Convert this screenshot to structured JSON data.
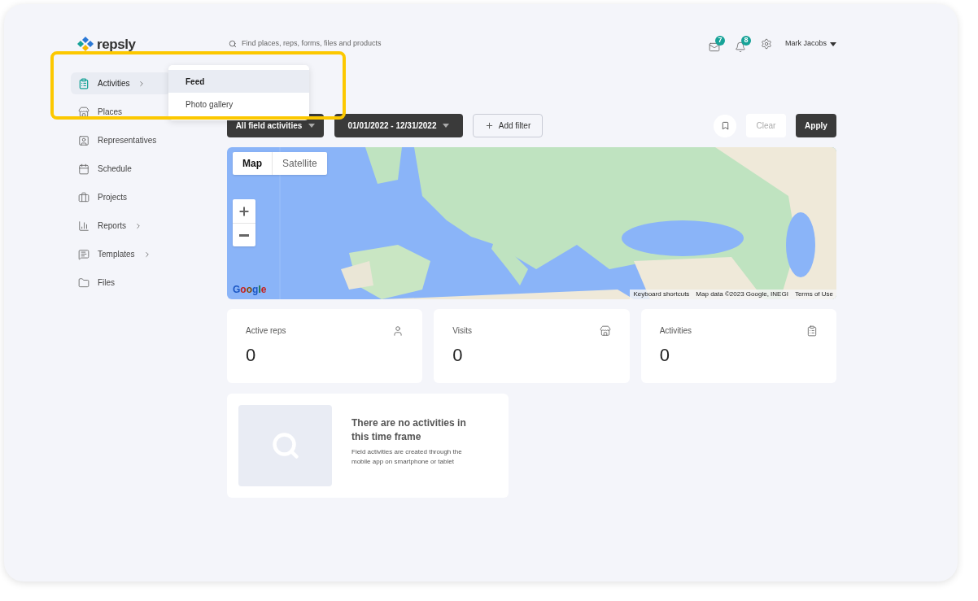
{
  "logo": {
    "text": "repsly"
  },
  "search": {
    "placeholder": "Find places, reps, forms, files and products"
  },
  "header": {
    "mail_count": "7",
    "notification_count": "8",
    "user_name": "Mark Jacobs"
  },
  "sidebar": {
    "items": [
      {
        "label": "Activities",
        "selected": true,
        "has_submenu": true
      },
      {
        "label": "Places",
        "selected": false,
        "has_submenu": false
      },
      {
        "label": "Representatives",
        "selected": false,
        "has_submenu": false
      },
      {
        "label": "Schedule",
        "selected": false,
        "has_submenu": false
      },
      {
        "label": "Projects",
        "selected": false,
        "has_submenu": false
      },
      {
        "label": "Reports",
        "selected": false,
        "has_submenu": true
      },
      {
        "label": "Templates",
        "selected": false,
        "has_submenu": true
      },
      {
        "label": "Files",
        "selected": false,
        "has_submenu": false
      }
    ]
  },
  "submenu": {
    "items": [
      {
        "label": "Feed",
        "selected": true
      },
      {
        "label": "Photo gallery",
        "selected": false
      }
    ]
  },
  "highlight": true,
  "filters": {
    "activity_type": "All field activities",
    "date_range": "01/01/2022 - 12/31/2022",
    "add_filter": "Add filter",
    "clear": "Clear",
    "apply": "Apply"
  },
  "map": {
    "types": [
      {
        "label": "Map",
        "selected": true
      },
      {
        "label": "Satellite",
        "selected": false
      }
    ],
    "logo": "Google",
    "footer": [
      "Keyboard shortcuts",
      "Map data ©2023 Google, INEGI",
      "Terms of Use"
    ]
  },
  "stats": [
    {
      "label": "Active reps",
      "value": "0"
    },
    {
      "label": "Visits",
      "value": "0"
    },
    {
      "label": "Activities",
      "value": "0"
    }
  ],
  "empty_state": {
    "title": "There are no activities in this time frame",
    "text": "Field activities are created through the mobile app on smartphone or tablet"
  }
}
